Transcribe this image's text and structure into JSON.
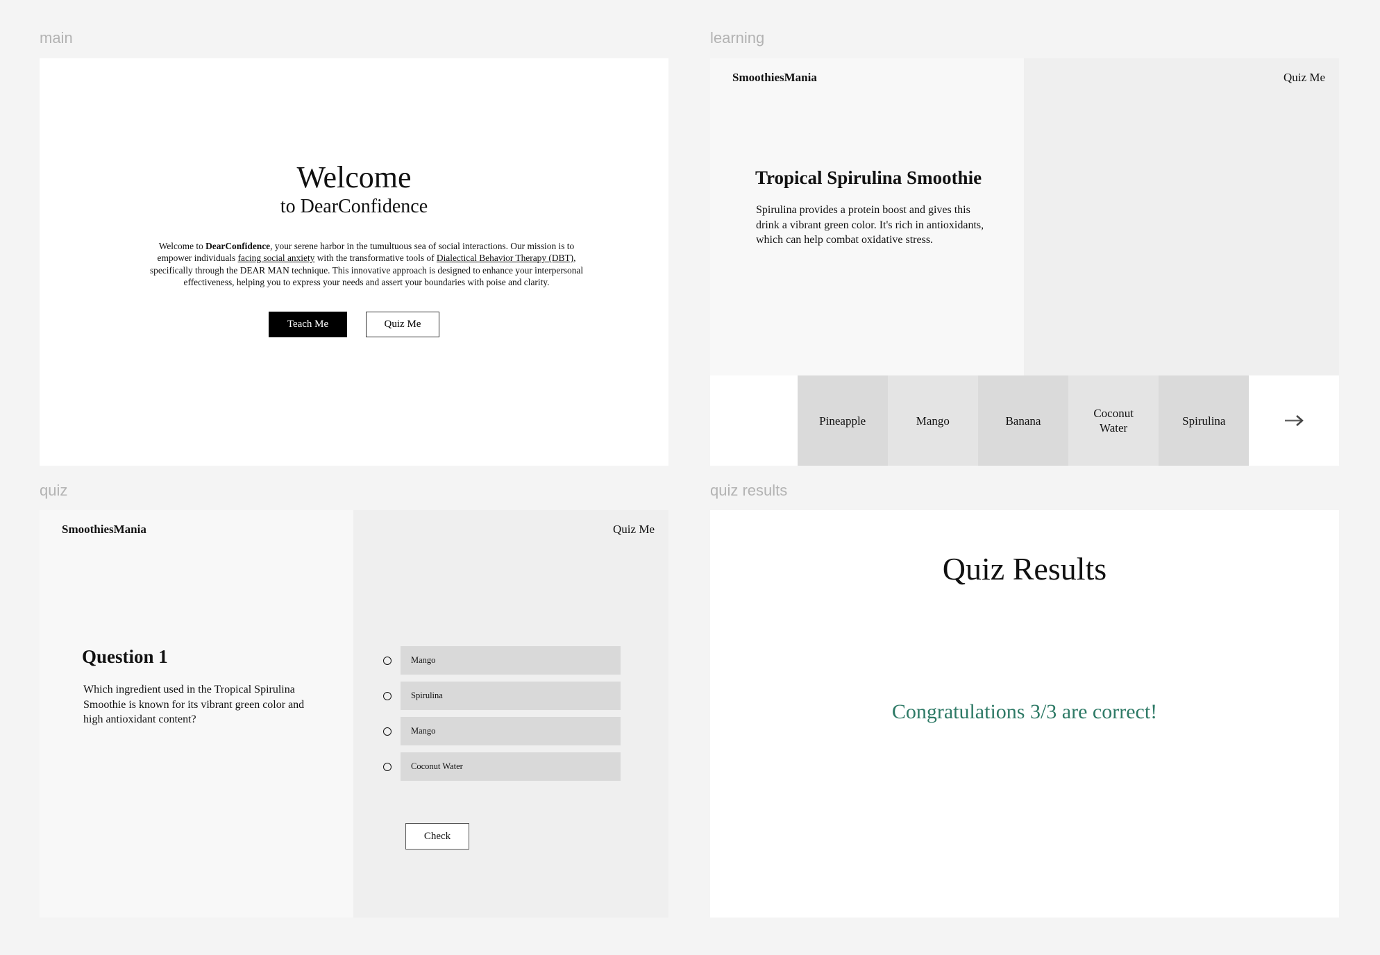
{
  "frames": {
    "main": {
      "label": "main",
      "welcome": "Welcome",
      "subtitle": "to DearConfidence",
      "paragraph": {
        "p1": "Welcome to ",
        "brand": "DearConfidence",
        "p2": ", your serene harbor in the tumultuous sea of social interactions. Our mission is to empower individuals ",
        "link1": "facing social anxiety",
        "p3": " with the transformative tools of ",
        "link2": "Dialectical Behavior Therapy (DBT)",
        "p4": ", specifically through the DEAR MAN technique. This innovative approach is designed to enhance your interpersonal effectiveness, helping you to express your needs and assert your boundaries with poise and clarity."
      },
      "buttons": {
        "teach": "Teach Me",
        "quiz": "Quiz Me"
      }
    },
    "learning": {
      "label": "learning",
      "brand": "SmoothiesMania",
      "nav_quiz": "Quiz Me",
      "title": "Tropical Spirulina Smoothie",
      "description": "Spirulina provides a protein boost and gives this drink a vibrant green color. It's rich in antioxidants, which can help combat oxidative stress.",
      "ingredients": [
        "Pineapple",
        "Mango",
        "Banana",
        "Coconut Water",
        "Spirulina"
      ],
      "next_icon": "arrow-right-icon"
    },
    "quiz": {
      "label": "quiz",
      "brand": "SmoothiesMania",
      "nav_quiz": "Quiz Me",
      "question_title": "Question 1",
      "question_text": "Which ingredient used in the Tropical Spirulina Smoothie is known for its vibrant green color and high antioxidant content?",
      "options": [
        "Mango",
        "Spirulina",
        "Mango",
        "Coconut Water"
      ],
      "check_label": "Check"
    },
    "results": {
      "label": "quiz results",
      "title": "Quiz Results",
      "message": "Congratulations 3/3 are correct!",
      "message_color": "#2e7a66"
    }
  }
}
